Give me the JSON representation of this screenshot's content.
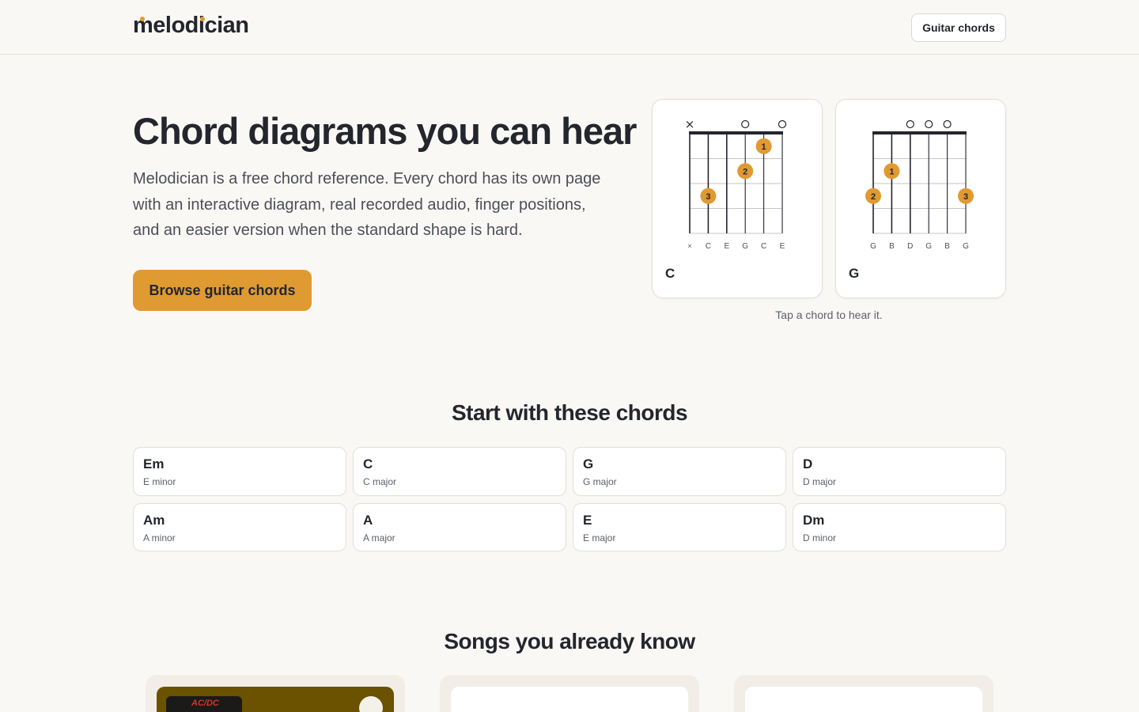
{
  "header": {
    "logo_text": "melodician",
    "nav_button_label": "Guitar chords"
  },
  "hero": {
    "title": "Chord diagrams you can hear",
    "description": "Melodician is a free chord reference. Every chord has its own page with an interactive diagram, real recorded audio, finger positions, and an easier version when the standard shape is hard.",
    "cta_label": "Browse guitar chords",
    "tap_hint": "Tap a chord to hear it."
  },
  "diagrams": [
    {
      "name": "C",
      "string_markers": [
        "×",
        "",
        "",
        "o",
        "",
        "o"
      ],
      "string_notes": [
        "×",
        "C",
        "E",
        "G",
        "C",
        "E"
      ],
      "fingers": [
        {
          "string": 5,
          "fret": 1,
          "label": "1"
        },
        {
          "string": 4,
          "fret": 2,
          "label": "2"
        },
        {
          "string": 2,
          "fret": 3,
          "label": "3"
        }
      ]
    },
    {
      "name": "G",
      "string_markers": [
        "",
        "",
        "o",
        "o",
        "o",
        ""
      ],
      "string_notes": [
        "G",
        "B",
        "D",
        "G",
        "B",
        "G"
      ],
      "fingers": [
        {
          "string": 2,
          "fret": 2,
          "label": "1"
        },
        {
          "string": 1,
          "fret": 3,
          "label": "2"
        },
        {
          "string": 6,
          "fret": 3,
          "label": "3"
        }
      ]
    }
  ],
  "chords_section": {
    "title": "Start with these chords",
    "items": [
      {
        "name": "Em",
        "full": "E minor"
      },
      {
        "name": "C",
        "full": "C major"
      },
      {
        "name": "G",
        "full": "G major"
      },
      {
        "name": "D",
        "full": "D major"
      },
      {
        "name": "Am",
        "full": "A minor"
      },
      {
        "name": "A",
        "full": "A major"
      },
      {
        "name": "E",
        "full": "E major"
      },
      {
        "name": "Dm",
        "full": "D minor"
      }
    ]
  },
  "songs_section": {
    "title": "Songs you already know",
    "album_art_text": "AC/DC"
  },
  "colors": {
    "accent": "#e09a32",
    "text": "#23262d",
    "background": "#faf8f5",
    "spotify_card": "#6a5200"
  },
  "icons": {
    "spotify": "spotify-icon"
  }
}
